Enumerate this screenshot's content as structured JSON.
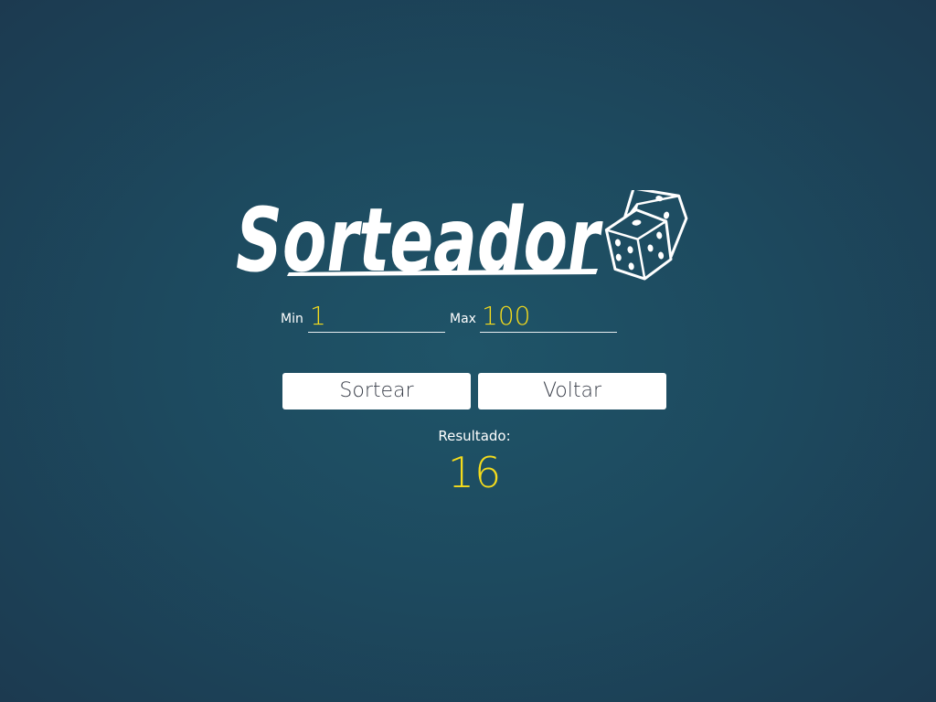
{
  "logo": {
    "text": "Sorteador",
    "icon": "dice-icon"
  },
  "form": {
    "min_label": "Min",
    "min_value": "1",
    "max_label": "Max",
    "max_value": "100"
  },
  "buttons": {
    "draw_label": "Sortear",
    "back_label": "Voltar"
  },
  "result": {
    "label": "Resultado:",
    "value": "16"
  },
  "colors": {
    "accent": "#f5dc1c",
    "background": "#1d4a5f",
    "button": "#ffffff"
  }
}
